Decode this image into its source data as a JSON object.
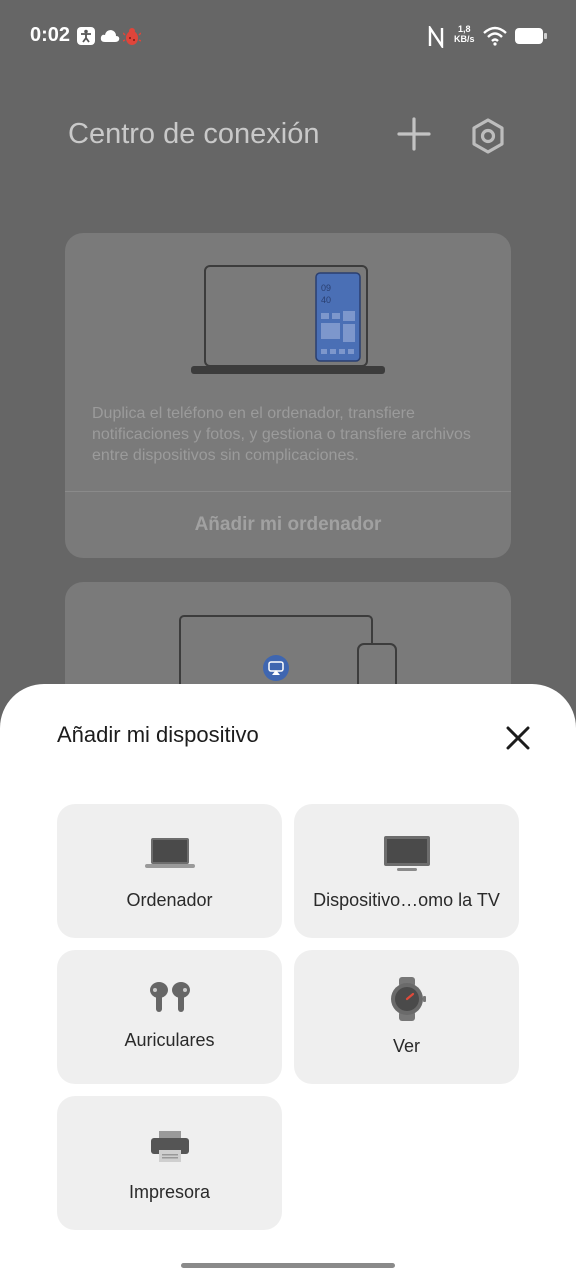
{
  "status_bar": {
    "time": "0:02",
    "net_speed_value": "1,8",
    "net_speed_unit": "KB/s",
    "icons": [
      "accessibility-icon",
      "cloud-icon",
      "bug-icon",
      "nfc-icon",
      "wifi-icon",
      "battery-icon"
    ]
  },
  "app": {
    "title": "Centro de conexión",
    "card_computer": {
      "phone_clock": "09\n40",
      "description": "Duplica el teléfono en el ordenador, transfiere notificaciones y fotos, y gestiona o transfiere archivos entre dispositivos sin complicaciones.",
      "button_label": "Añadir mi ordenador"
    }
  },
  "sheet": {
    "title": "Añadir mi dispositivo",
    "tiles": [
      {
        "label": "Ordenador",
        "icon": "laptop-icon"
      },
      {
        "label": "Dispositivo…omo la TV",
        "icon": "tv-icon"
      },
      {
        "label": "Auriculares",
        "icon": "earbuds-icon"
      },
      {
        "label": "Ver",
        "icon": "watch-icon"
      },
      {
        "label": "Impresora",
        "icon": "printer-icon"
      }
    ]
  },
  "colors": {
    "accent_blue": "#4a6fb5",
    "sheet_bg": "#ffffff",
    "tile_bg": "#efefef",
    "overlay": "#666666"
  }
}
